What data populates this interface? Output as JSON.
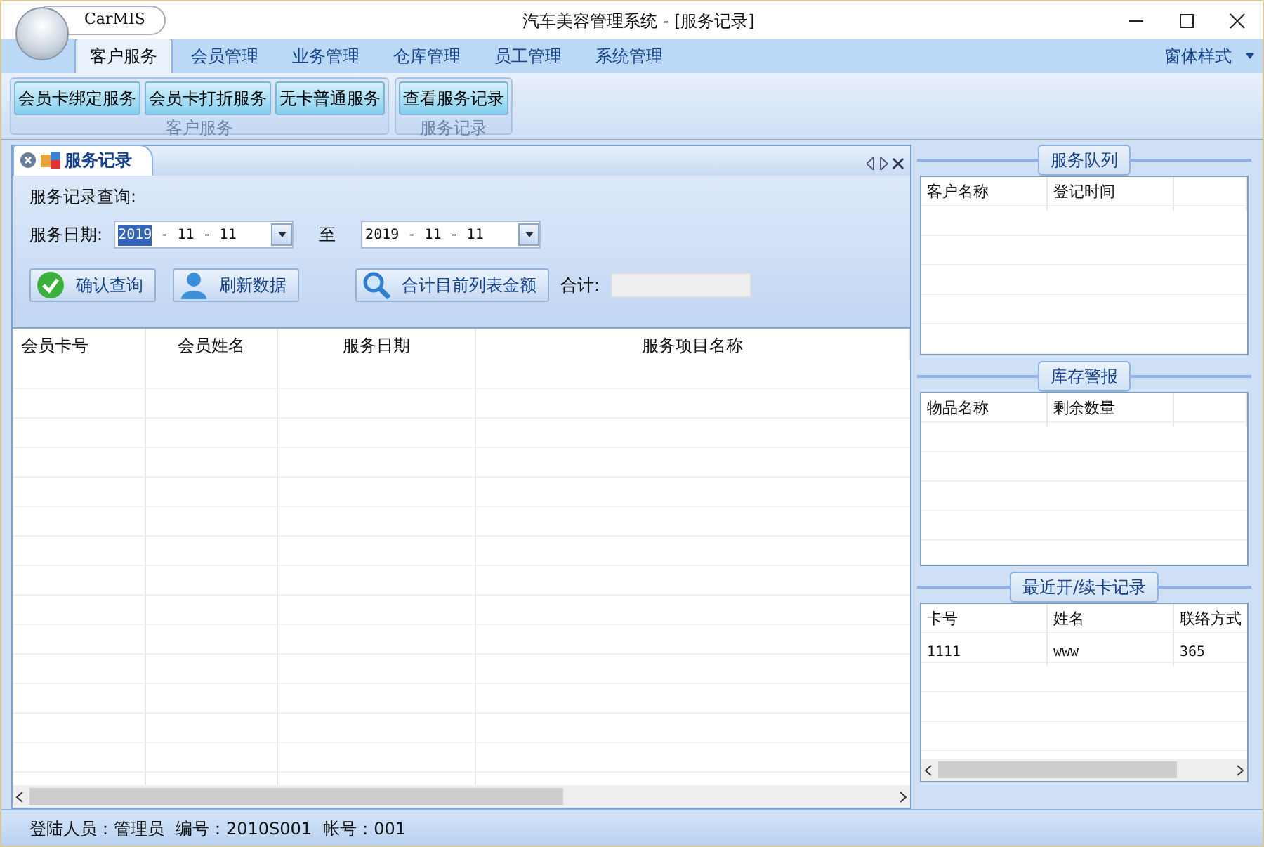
{
  "window": {
    "title": "汽车美容管理系统 - [服务记录]",
    "app_label": "CarMIS"
  },
  "ribbon": {
    "tabs": [
      {
        "label": "客户服务",
        "selected": true
      },
      {
        "label": "会员管理",
        "selected": false
      },
      {
        "label": "业务管理",
        "selected": false
      },
      {
        "label": "仓库管理",
        "selected": false
      },
      {
        "label": "员工管理",
        "selected": false
      },
      {
        "label": "系统管理",
        "selected": false
      }
    ],
    "style_menu": "窗体样式",
    "groups": [
      {
        "label": "客户服务",
        "buttons": [
          "会员卡绑定服务",
          "会员卡打折服务",
          "无卡普通服务"
        ]
      },
      {
        "label": "服务记录",
        "buttons": [
          "查看服务记录"
        ]
      }
    ]
  },
  "document_tab": {
    "title": "服务记录"
  },
  "query": {
    "heading": "服务记录查询:",
    "date_label": "服务日期:",
    "date_from": {
      "segments": [
        {
          "text": "2019",
          "selected": true
        },
        {
          "text": " - 11 - 11",
          "selected": false
        }
      ]
    },
    "to_label": "至",
    "date_to": {
      "segments": [
        {
          "text": "2019 - 11 - 11",
          "selected": false
        }
      ]
    },
    "buttons": [
      {
        "label": "确认查询",
        "kind": "check"
      },
      {
        "label": "刷新数据",
        "kind": "person"
      },
      {
        "label": "合计目前列表金额",
        "kind": "search"
      }
    ],
    "total_label": "合计:"
  },
  "table": {
    "columns": [
      "会员卡号",
      "会员姓名",
      "服务日期",
      "服务项目名称"
    ]
  },
  "side_panels": [
    {
      "title": "服务队列",
      "columns": [
        "客户名称",
        "登记时间"
      ]
    },
    {
      "title": "库存警报",
      "columns": [
        "物品名称",
        "剩余数量"
      ]
    },
    {
      "title": "最近开/续卡记录",
      "columns": [
        "卡号",
        "姓名",
        "联络方式"
      ],
      "rows": [
        [
          "1111",
          "www",
          "365"
        ]
      ]
    }
  ],
  "status_bar": [
    "登陆人员：管理员",
    "编号：2010S001",
    "帐号：001"
  ]
}
